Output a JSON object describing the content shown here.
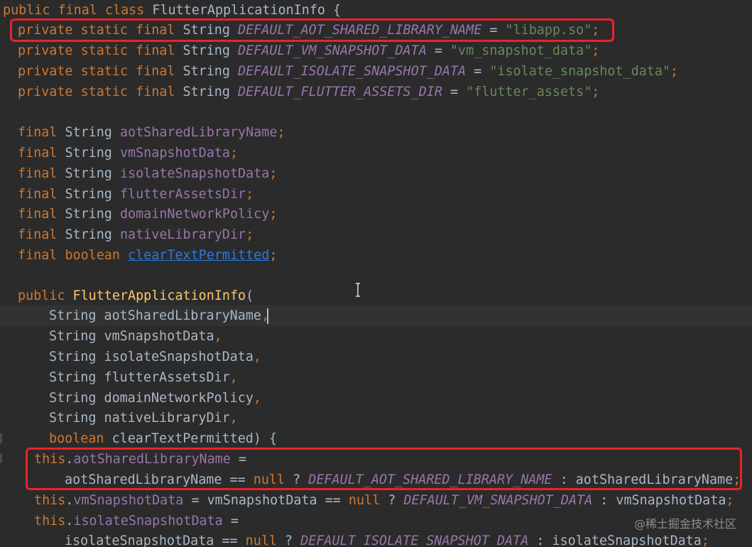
{
  "colors": {
    "background": "#2B2B2B",
    "keyword": "#CC7832",
    "method_name": "#FFC66D",
    "constant": "#9876AA",
    "string": "#6A8759",
    "plain": "#A9B7C6",
    "link": "#287BDE",
    "highlight_box": "#E8242A"
  },
  "code": {
    "class_decl": {
      "modifiers": "public final class ",
      "name": "FlutterApplicationInfo",
      "brace": " {"
    },
    "constants": [
      {
        "mods": "private static final ",
        "type": "String ",
        "name": "DEFAULT_AOT_SHARED_LIBRARY_NAME",
        "eq": " = ",
        "value": "\"libapp.so\"",
        "semi": ";"
      },
      {
        "mods": "private static final ",
        "type": "String ",
        "name": "DEFAULT_VM_SNAPSHOT_DATA",
        "eq": " = ",
        "value": "\"vm_snapshot_data\"",
        "semi": ";"
      },
      {
        "mods": "private static final ",
        "type": "String ",
        "name": "DEFAULT_ISOLATE_SNAPSHOT_DATA",
        "eq": " = ",
        "value": "\"isolate_snapshot_data\"",
        "semi": ";"
      },
      {
        "mods": "private static final ",
        "type": "String ",
        "name": "DEFAULT_FLUTTER_ASSETS_DIR",
        "eq": " = ",
        "value": "\"flutter_assets\"",
        "semi": ";"
      }
    ],
    "fields": [
      {
        "mod": "final ",
        "type": "String ",
        "name": "aotSharedLibraryName",
        "semi": ";"
      },
      {
        "mod": "final ",
        "type": "String ",
        "name": "vmSnapshotData",
        "semi": ";"
      },
      {
        "mod": "final ",
        "type": "String ",
        "name": "isolateSnapshotData",
        "semi": ";"
      },
      {
        "mod": "final ",
        "type": "String ",
        "name": "flutterAssetsDir",
        "semi": ";"
      },
      {
        "mod": "final ",
        "type": "String ",
        "name": "domainNetworkPolicy",
        "semi": ";"
      },
      {
        "mod": "final ",
        "type": "String ",
        "name": "nativeLibraryDir",
        "semi": ";"
      },
      {
        "mod": "final ",
        "type": "boolean ",
        "name": "clearTextPermitted",
        "semi": ";"
      }
    ],
    "constructor": {
      "modifier": "public ",
      "name": "FlutterApplicationInfo",
      "open_paren": "("
    },
    "params": [
      {
        "type": "String ",
        "name": "aotSharedLibraryName",
        "punct": ","
      },
      {
        "type": "String ",
        "name": "vmSnapshotData",
        "punct": ","
      },
      {
        "type": "String ",
        "name": "isolateSnapshotData",
        "punct": ","
      },
      {
        "type": "String ",
        "name": "flutterAssetsDir",
        "punct": ","
      },
      {
        "type": "String ",
        "name": "domainNetworkPolicy",
        "punct": ","
      },
      {
        "type": "String ",
        "name": "nativeLibraryDir",
        "punct": ","
      },
      {
        "type": "boolean ",
        "name": "clearTextPermitted",
        "punct": ") {"
      }
    ],
    "assign1": {
      "this_kw": "this",
      "dot": ".",
      "field": "aotSharedLibraryName",
      "eq": " =",
      "var": "aotSharedLibraryName",
      "cmp": " == ",
      "null_kw": "null",
      "q": " ? ",
      "const": "DEFAULT_AOT_SHARED_LIBRARY_NAME",
      "colon": " : ",
      "alt": "aotSharedLibraryName",
      "semi": ";"
    },
    "assign2": {
      "this_kw": "this",
      "dot": ".",
      "field": "vmSnapshotData",
      "eq": " = ",
      "var": "vmSnapshotData",
      "cmp": " == ",
      "null_kw": "null",
      "q": " ? ",
      "const": "DEFAULT_VM_SNAPSHOT_DATA",
      "colon": " : ",
      "alt": "vmSnapshotData",
      "semi": ";"
    },
    "assign3": {
      "this_kw": "this",
      "dot": ".",
      "field": "isolateSnapshotData",
      "eq": " =",
      "var": "isolateSnapshotData",
      "cmp": " == ",
      "null_kw": "null",
      "q": " ? ",
      "const": "DEFAULT_ISOLATE_SNAPSHOT_DATA",
      "colon": " : ",
      "alt": "isolateSnapshotData",
      "semi": ";"
    }
  },
  "watermark": "@稀土掘金技术社区"
}
